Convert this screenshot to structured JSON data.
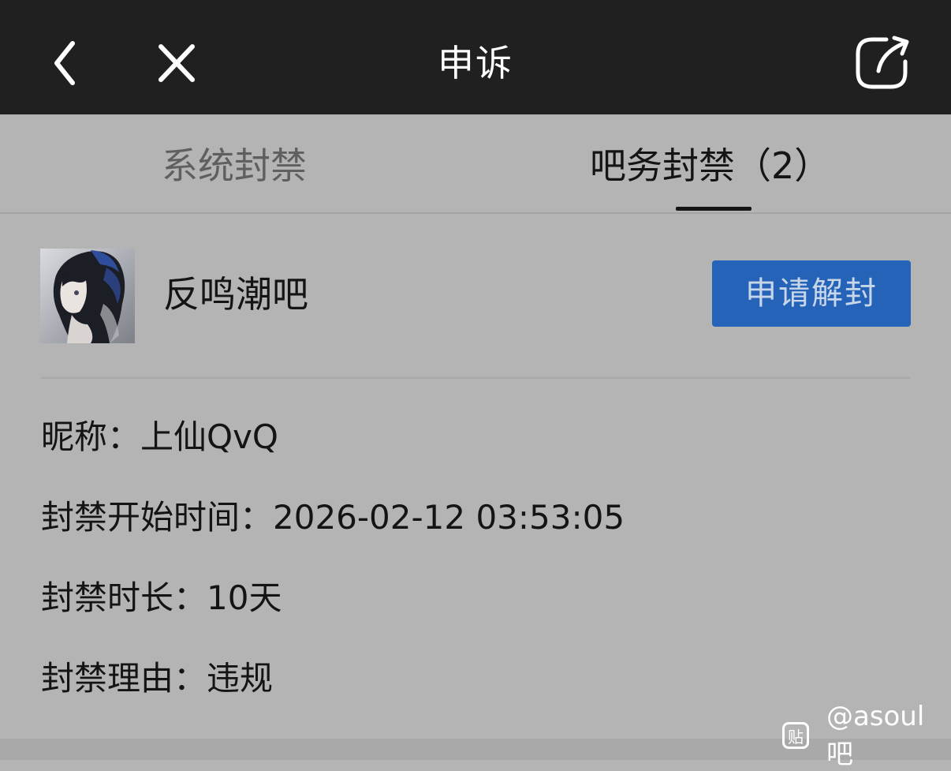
{
  "header": {
    "title": "申诉",
    "back_icon": "chevron-left-icon",
    "close_icon": "close-icon",
    "share_icon": "share-icon"
  },
  "tabs": [
    {
      "label": "系统封禁",
      "active": false
    },
    {
      "label": "吧务封禁（2）",
      "active": true
    }
  ],
  "forum": {
    "name": "反鸣潮吧",
    "avatar": "forum-avatar",
    "action_label": "申请解封"
  },
  "details": {
    "nickname_label": "昵称：",
    "nickname": "上仙QvQ",
    "start_label": "封禁开始时间：",
    "start_time": "2026-02-12 03:53:05",
    "duration_label": "封禁时长：",
    "duration": "10天",
    "reason_label": "封禁理由：",
    "reason": "违规"
  },
  "watermark": {
    "icon_glyph": "贴",
    "text": "@asoul吧"
  },
  "colors": {
    "topbar": "#202020",
    "background": "#b3b4b3",
    "accent_button": "#2563b8"
  }
}
